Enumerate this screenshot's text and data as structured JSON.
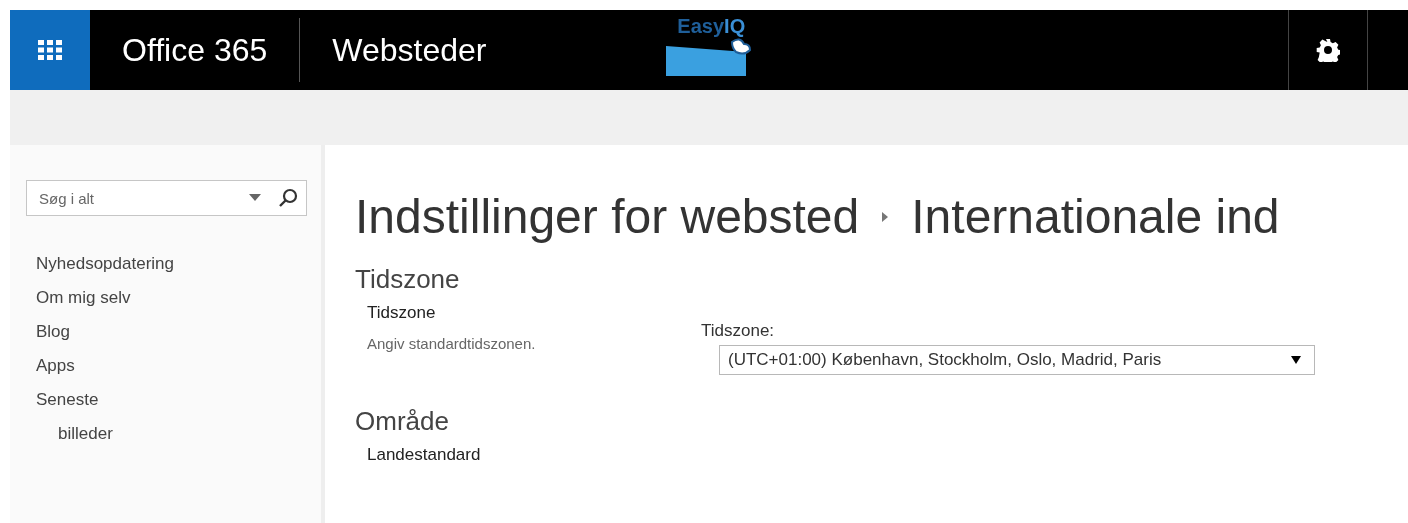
{
  "top_bar": {
    "app_name": "Office 365",
    "site_name": "Websteder",
    "logo_text": "Easy",
    "logo_text_bold": "IQ"
  },
  "sidebar": {
    "search": {
      "placeholder": "Søg i alt"
    },
    "items": [
      {
        "label": "Nyhedsopdatering"
      },
      {
        "label": "Om mig selv"
      },
      {
        "label": "Blog"
      },
      {
        "label": "Apps"
      },
      {
        "label": "Seneste",
        "children": [
          {
            "label": "billeder"
          }
        ]
      }
    ]
  },
  "breadcrumb": [
    "Indstillinger for websted",
    "Internationale ind"
  ],
  "sections": [
    {
      "title": "Tidszone",
      "subtitle": "Tidszone",
      "description": "Angiv standardtidszonen.",
      "field_label": "Tidszone:",
      "value": "(UTC+01:00) København, Stockholm, Oslo, Madrid, Paris"
    },
    {
      "title": "Område",
      "subtitle": "Landestandard"
    }
  ]
}
